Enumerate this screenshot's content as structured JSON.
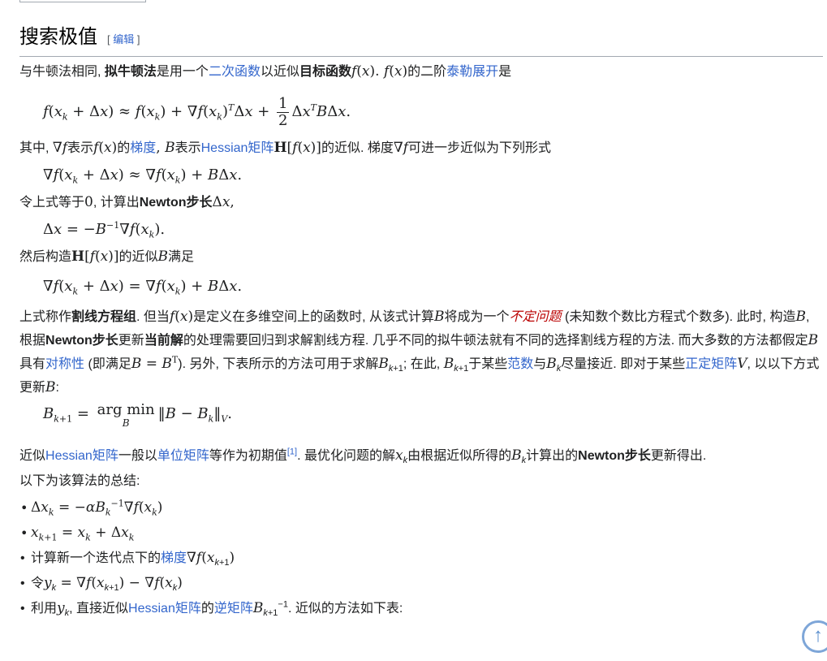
{
  "section": {
    "title": "搜索极值",
    "edit_bracket_open": "[",
    "edit_label": "编辑",
    "edit_bracket_close": "]"
  },
  "p1": {
    "t1": "与牛顿法相同, ",
    "b1": "拟牛顿法",
    "t2": "是用一个",
    "l1": "二次函数",
    "t3": "以近似",
    "b2": "目标函数",
    "t4": "的二阶",
    "l2": "泰勒展开",
    "t5": "是"
  },
  "p2": {
    "t1": "其中, ",
    "t2": "表示",
    "t3": "的",
    "l1": "梯度",
    "t4": "表示",
    "l2": "Hessian矩阵",
    "t5": "的近似. 梯度",
    "t6": "可进一步近似为下列形式"
  },
  "p3": {
    "t1": "令上式等于",
    "t2": ", 计算出",
    "b1": "Newton步长"
  },
  "p4": {
    "t1": "然后构造",
    "t2": "的近似",
    "t3": "满足"
  },
  "p5": {
    "t1": "上式称作",
    "b1": "割线方程组",
    "t2": ". 但当",
    "t3": "是定义在多维空间上的函数时, 从该式计算",
    "t4": "将成为一个",
    "l1": "不定问题",
    "t5": "(未知数个数比方程式个数多). 此时, 构造",
    "t6": ", 根据",
    "b2": "Newton步长",
    "t7": "更新",
    "b3": "当前解",
    "t8": "的处理需要回归到求解割线方程. 几乎不同的拟牛顿法就有不同的选择割线方程的方法. 而大多数的方法都假定",
    "t9": "具有",
    "l2": "对称性",
    "t10": "(即满足",
    "t11": "). 另外, 下表所示的方法可用于求解",
    "t12": "; 在此, ",
    "t13": "于某些",
    "l3": "范数",
    "t14": "与",
    "t15": "尽量接近. 即对于某些",
    "l4": "正定矩阵",
    "t16": ", 以以下方式更新",
    "t17": ":"
  },
  "p6": {
    "t1": "近似",
    "l1": "Hessian矩阵",
    "t2": "一般以",
    "l2": "单位矩阵",
    "t3": "等作为初期值",
    "ref": "[1]",
    "t4": ". 最优化问题的解",
    "t5": "由根据近似所得的",
    "t6": "计算出的",
    "b1": "Newton步长",
    "t7": "更新得出."
  },
  "p7": {
    "t1": "以下为该算法的总结:"
  },
  "summary": {
    "i3_t1": "计算新一个迭代点下的",
    "i3_l1": "梯度",
    "i4_t1": "令",
    "i5_t1": "利用",
    "i5_t2": ", 直接近似",
    "i5_l1": "Hessian矩阵",
    "i5_t3": "的",
    "i5_l2": "逆矩阵",
    "i5_t4": ". 近似的方法如下表:"
  },
  "icons": {
    "scroll_top": "arrow-up-circle-icon"
  }
}
